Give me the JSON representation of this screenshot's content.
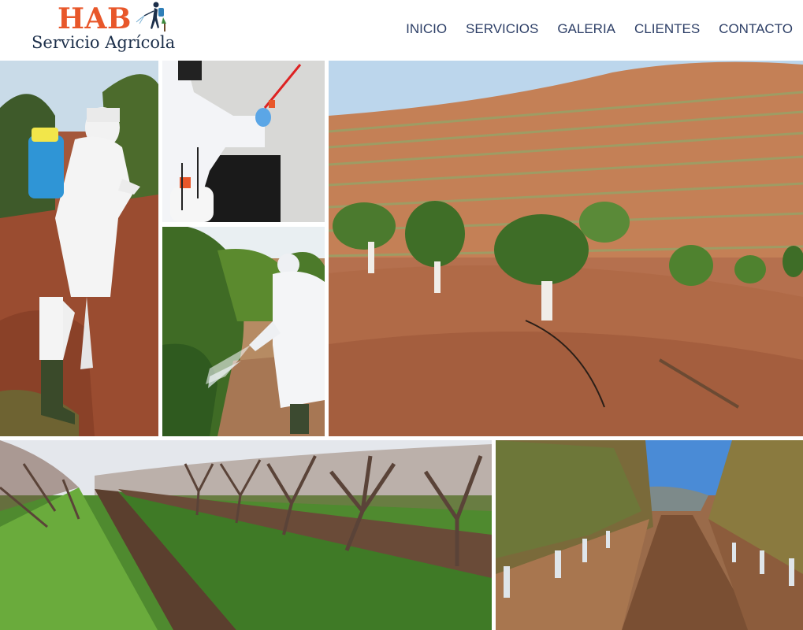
{
  "brand": {
    "name": "HAB",
    "tagline": "Servicio Agrícola",
    "name_color": "#e8572a",
    "tagline_color": "#1c2f4a"
  },
  "nav": {
    "color": "#2c3e66",
    "items": [
      {
        "label": "INICIO"
      },
      {
        "label": "SERVICIOS"
      },
      {
        "label": "GALERIA"
      },
      {
        "label": "CLIENTES"
      },
      {
        "label": "CONTACTO"
      }
    ]
  },
  "gallery": {
    "photos": [
      {
        "subject": "worker-backpack-sprayer-orchard"
      },
      {
        "subject": "worker-hand-sprayer-indoor"
      },
      {
        "subject": "worker-spraying-citrus-trees"
      },
      {
        "subject": "hillside-terraced-avocado-plantation"
      },
      {
        "subject": "leafless-fruit-orchard-green-grass"
      },
      {
        "subject": "young-tree-rows-irrigation"
      }
    ]
  }
}
